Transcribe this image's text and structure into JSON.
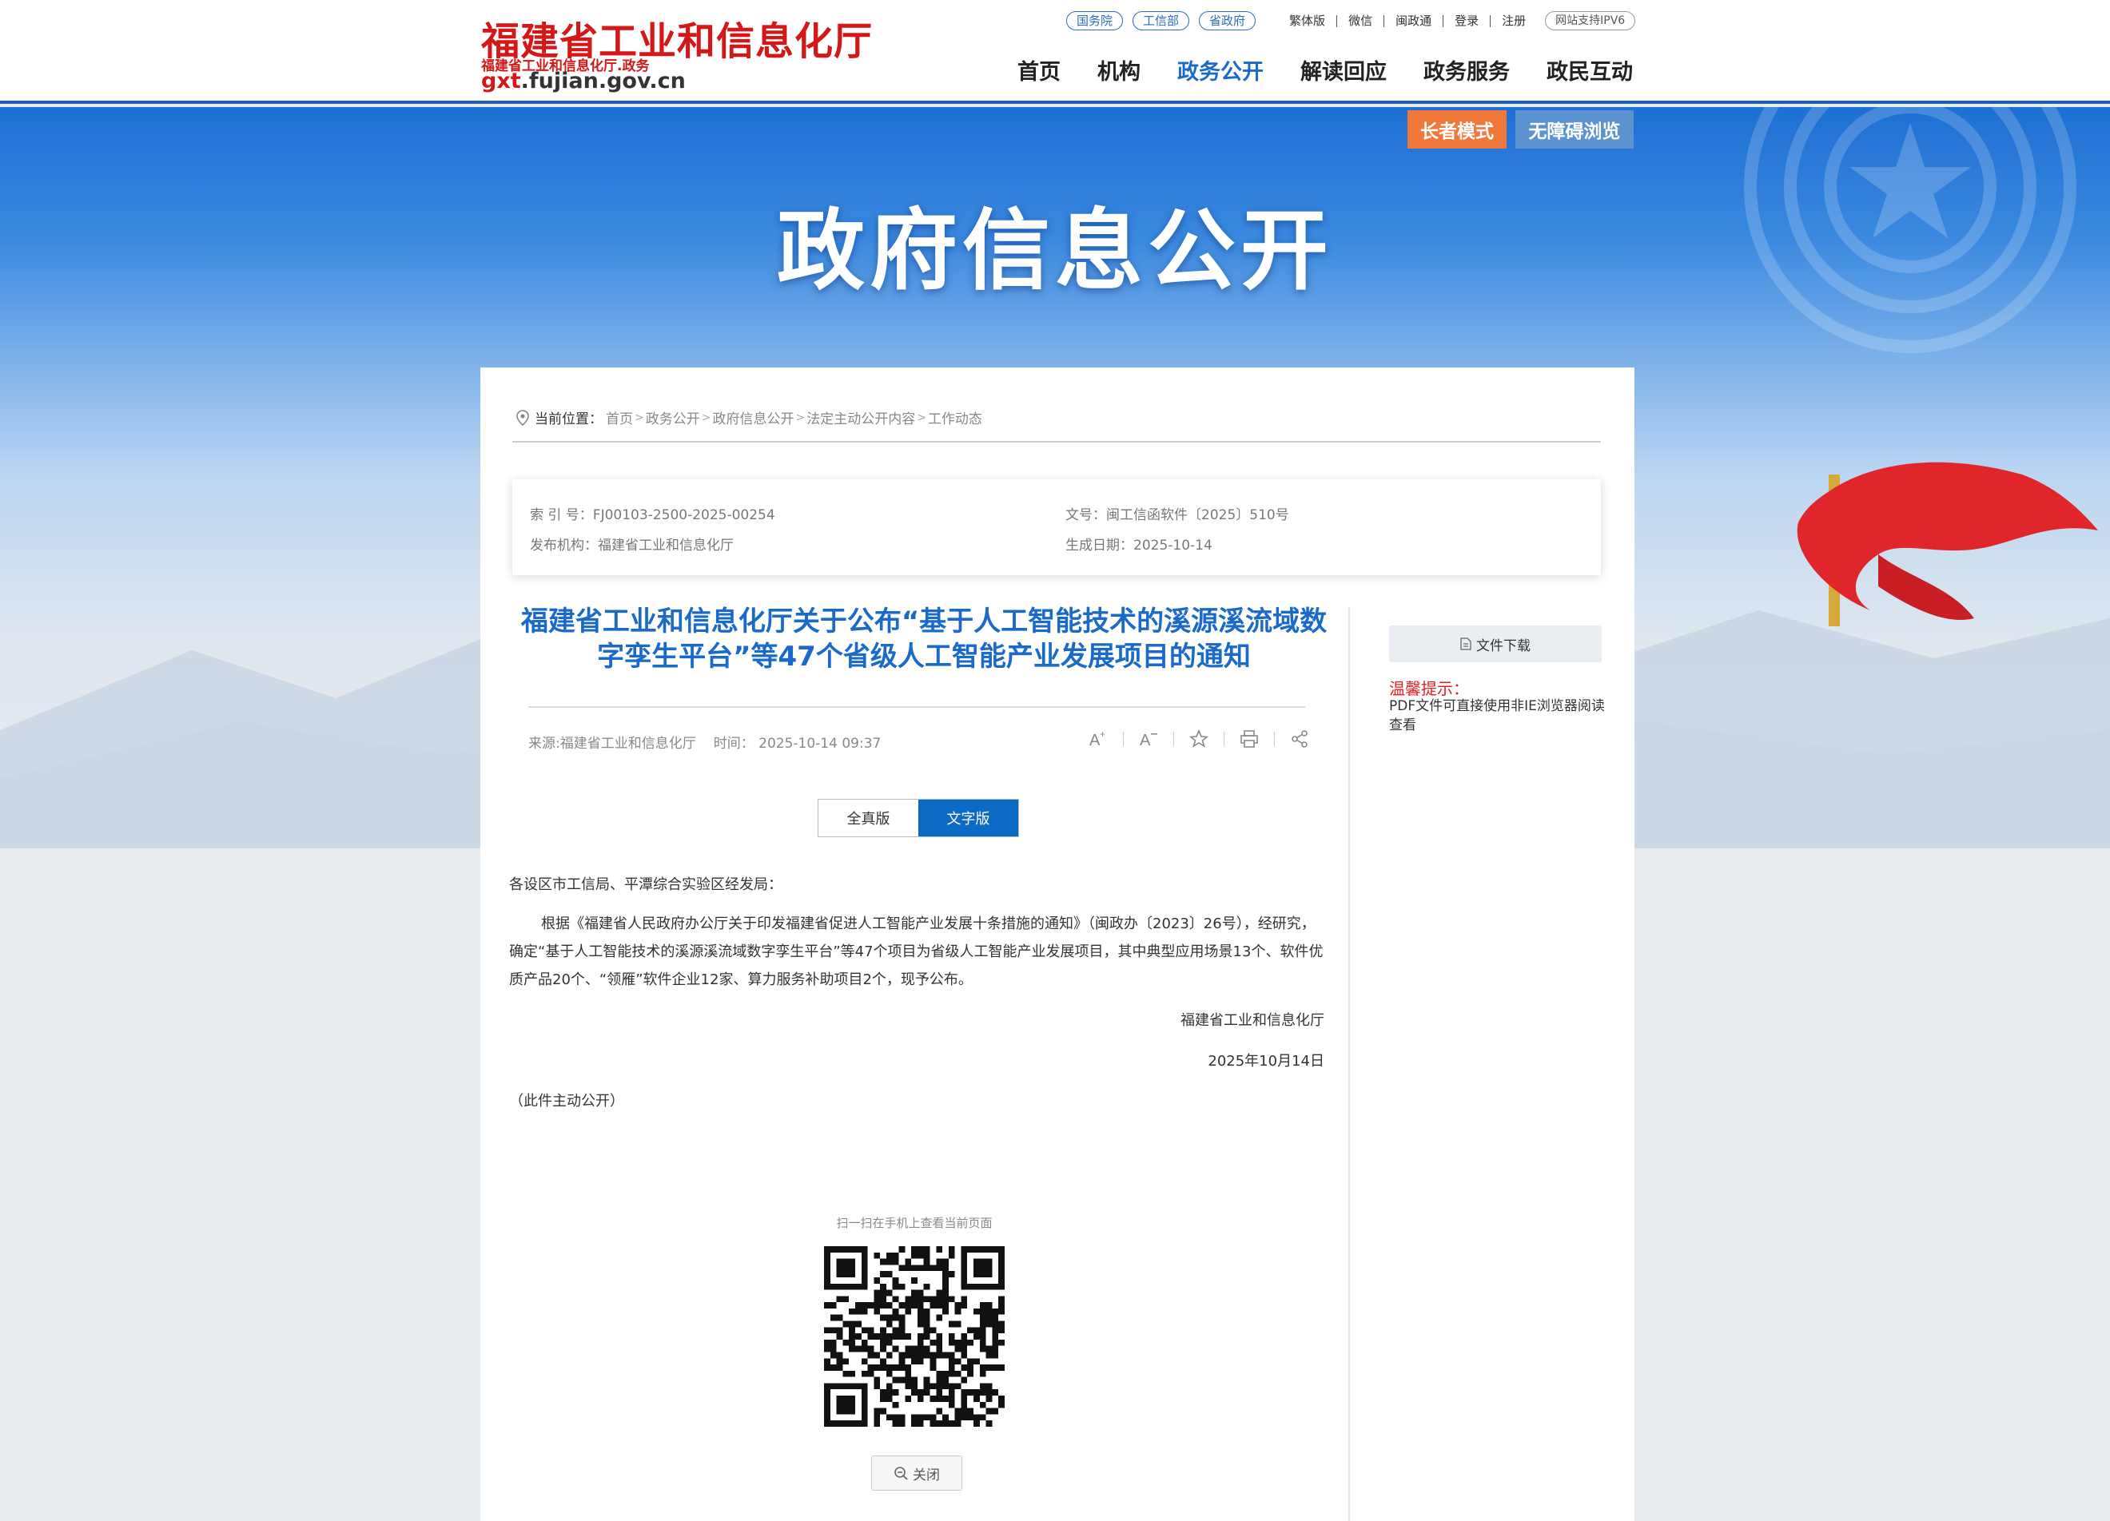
{
  "header": {
    "logo_title": "福建省工业和信息化厅",
    "logo_subtitle": "福建省工业和信息化厅.政务",
    "logo_domain_prefix": "gxt",
    "logo_domain_suffix": ".fujian.gov.cn",
    "pills": [
      "国务院",
      "工信部",
      "省政府"
    ],
    "top_links": [
      "繁体版",
      "微信",
      "闽政通",
      "登录",
      "注册"
    ],
    "ipv6": "网站支持IPV6",
    "nav": [
      "首页",
      "机构",
      "政务公开",
      "解读回应",
      "政务服务",
      "政民互动"
    ],
    "nav_active": "政务公开"
  },
  "banner": {
    "elder_mode": "长者模式",
    "accessible": "无障碍浏览",
    "title": "政府信息公开"
  },
  "breadcrumb": {
    "label": "当前位置：",
    "items": [
      "首页",
      "政务公开",
      "政府信息公开",
      "法定主动公开内容",
      "工作动态"
    ]
  },
  "info": {
    "index_no": "索 引 号：FJ00103-2500-2025-00254",
    "doc_no": "文号：闽工信函软件〔2025〕510号",
    "publisher": "发布机构：福建省工业和信息化厅",
    "created": "生成日期：2025-10-14"
  },
  "article": {
    "title": "福建省工业和信息化厅关于公布“基于人工智能技术的溪源溪流域数字孪生平台”等47个省级人工智能产业发展项目的通知",
    "source": "来源:福建省工业和信息化厅",
    "time": "时间：  2025-10-14 09:37",
    "view_full": "全真版",
    "view_text": "文字版",
    "salutation": "各设区市工信局、平潭综合实验区经发局：",
    "body": "根据《福建省人民政府办公厅关于印发福建省促进人工智能产业发展十条措施的通知》（闽政办〔2023〕26号），经研究，确定“基于人工智能技术的溪源溪流域数字孪生平台”等47个项目为省级人工智能产业发展项目，其中典型应用场景13个、软件优质产品20个、“领雁”软件企业12家、算力服务补助项目2个，现予公布。",
    "signature": "福建省工业和信息化厅",
    "date": "2025年10月14日",
    "publicity": "（此件主动公开）"
  },
  "sidebar": {
    "download": "文件下载",
    "tip_title": "温馨提示：",
    "tip_text": "PDF文件可直接使用非IE浏览器阅读查看"
  },
  "qr": {
    "caption": "扫一扫在手机上查看当前页面",
    "close": "关闭"
  },
  "colors": {
    "brand_red": "#d41818",
    "link_blue": "#1a6ac9",
    "toggle_blue": "#0b6bc4",
    "elder_orange": "#f0783a",
    "tip_red": "#e02020"
  }
}
